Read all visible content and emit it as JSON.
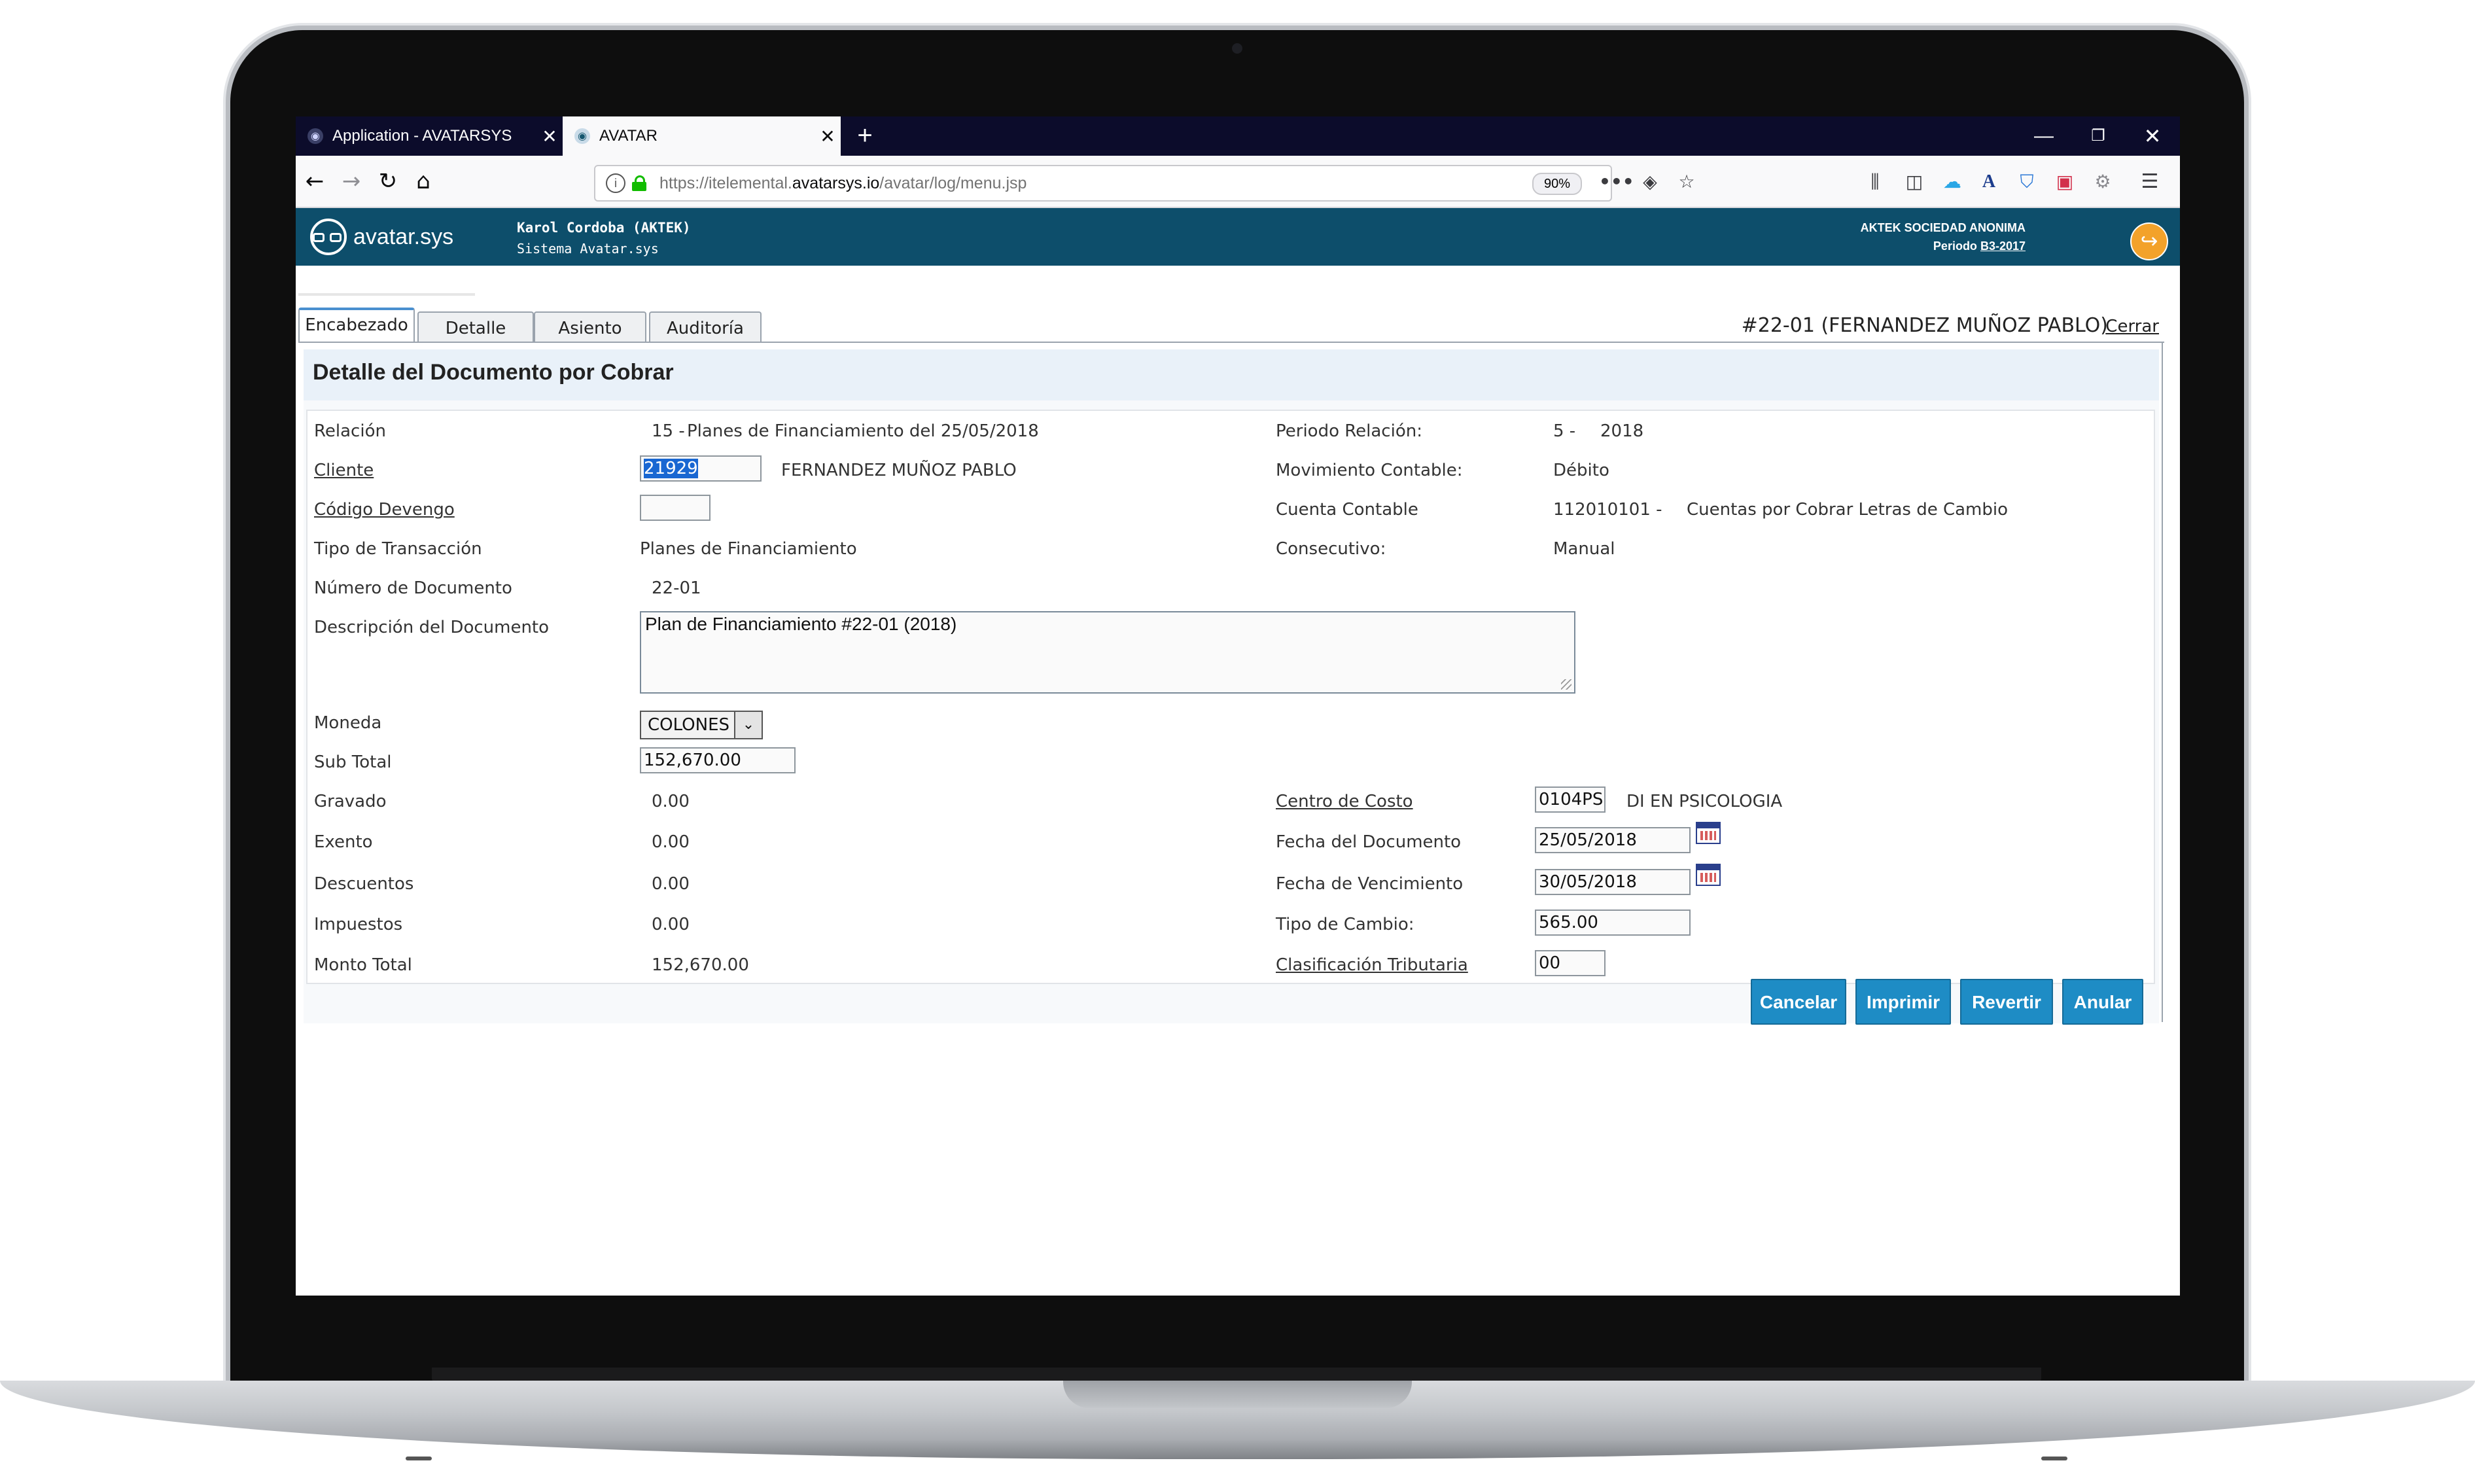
{
  "browser": {
    "tabs": [
      {
        "title": "Application - AVATARSYS"
      },
      {
        "title": "AVATAR"
      }
    ],
    "new_tab": "+",
    "url_prefix": "https://itelemental.",
    "url_domain": "avatarsys.io",
    "url_path": "/avatar/log/menu.jsp",
    "zoom": "90%"
  },
  "app": {
    "logo_text": "avatar.sys",
    "user_name": "Karol Cordoba (AKTEK)",
    "system_name": "Sistema Avatar.sys",
    "company": "AKTEK SOCIEDAD ANONIMA",
    "period_label": "Periodo",
    "period_value": "B3-2017"
  },
  "tabs": [
    "Encabezado",
    "Detalle",
    "Asiento",
    "Auditoría"
  ],
  "doc_ref": "#22-01 (FERNANDEZ MUÑOZ PABLO)",
  "close_label": "Cerrar",
  "panel_title": "Detalle del Documento por Cobrar",
  "form": {
    "relacion": {
      "label": "Relación",
      "num": "15 -",
      "text": "Planes de Financiamiento del 25/05/2018"
    },
    "cliente": {
      "label": "Cliente",
      "code": "21929",
      "name": "FERNANDEZ MUÑOZ PABLO"
    },
    "codigo_devengo": {
      "label": "Código Devengo",
      "value": ""
    },
    "tipo_transaccion": {
      "label": "Tipo de Transacción",
      "value": "Planes de Financiamiento"
    },
    "numero_documento": {
      "label": "Número de Documento",
      "value": "22-01"
    },
    "descripcion": {
      "label": "Descripción del Documento",
      "value": "Plan de Financiamiento #22-01 (2018)"
    },
    "moneda": {
      "label": "Moneda",
      "value": "COLONES"
    },
    "sub_total": {
      "label": "Sub Total",
      "value": "152,670.00"
    },
    "gravado": {
      "label": "Gravado",
      "value": "0.00"
    },
    "exento": {
      "label": "Exento",
      "value": "0.00"
    },
    "descuentos": {
      "label": "Descuentos",
      "value": "0.00"
    },
    "impuestos": {
      "label": "Impuestos",
      "value": "0.00"
    },
    "monto_total": {
      "label": "Monto Total",
      "value": "152,670.00"
    },
    "periodo_relacion": {
      "label": "Periodo Relación:",
      "num": "5 -",
      "year": "2018"
    },
    "movimiento_contable": {
      "label": "Movimiento Contable:",
      "value": "Débito"
    },
    "cuenta_contable": {
      "label": "Cuenta Contable",
      "code": "112010101 -",
      "text": "Cuentas por Cobrar Letras de Cambio"
    },
    "consecutivo": {
      "label": "Consecutivo:",
      "value": "Manual"
    },
    "centro_costo": {
      "label": "Centro de Costo",
      "code": "0104PS",
      "text": "DI EN PSICOLOGIA"
    },
    "fecha_documento": {
      "label": "Fecha del Documento",
      "value": "25/05/2018"
    },
    "fecha_vencimiento": {
      "label": "Fecha de Vencimiento",
      "value": "30/05/2018"
    },
    "tipo_cambio": {
      "label": "Tipo de Cambio:",
      "value": "565.00"
    },
    "clasificacion_tributaria": {
      "label": "Clasificación Tributaria",
      "value": "00"
    }
  },
  "buttons": {
    "cancelar": "Cancelar",
    "imprimir": "Imprimir",
    "revertir": "Revertir",
    "anular": "Anular"
  },
  "colors": {
    "header_bg": "#0d4e6b",
    "button_bg": "#1e8cc5",
    "logout_accent": "#f3a22a",
    "tab_strip": "#0c0c2b"
  }
}
